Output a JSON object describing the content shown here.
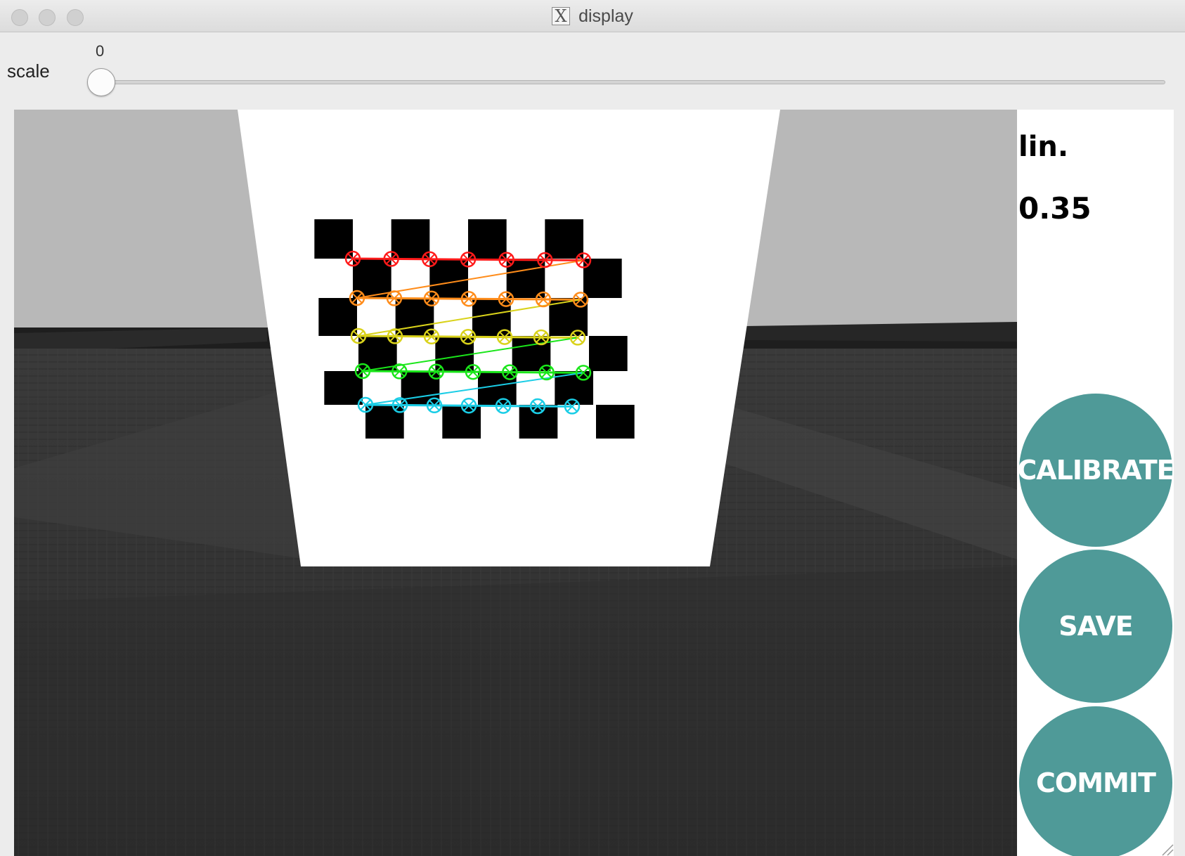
{
  "window": {
    "title": "display",
    "app_icon": "x11-icon",
    "app_icon_glyph": "X"
  },
  "trackbar": {
    "label": "scale",
    "value": "0",
    "min": 0,
    "position_fraction": 0
  },
  "panel": {
    "metric_label": "lin.",
    "metric_value": "0.35",
    "buttons": [
      {
        "label": "CALIBRATE"
      },
      {
        "label": "SAVE"
      },
      {
        "label": "COMMIT"
      }
    ]
  },
  "detection": {
    "row_colors": [
      "#ff1a1a",
      "#ff8c1a",
      "#d9d21a",
      "#1ae61a",
      "#1acde6"
    ],
    "grid_cols": 7,
    "grid_rows": 5
  },
  "colors": {
    "button_teal": "#4f9a98",
    "board_white": "#ffffff",
    "square_black": "#000000"
  }
}
